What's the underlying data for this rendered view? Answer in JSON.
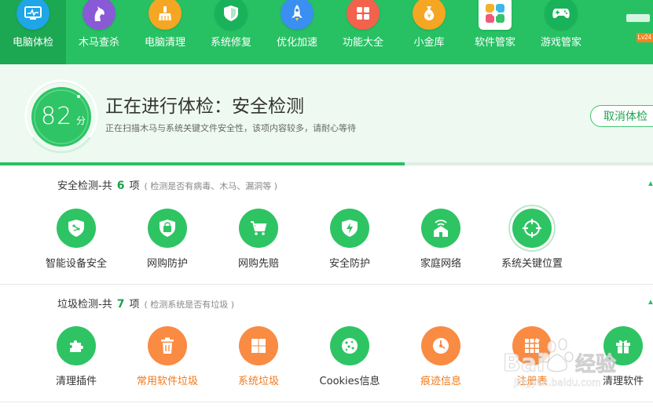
{
  "nav": {
    "items": [
      {
        "label": "电脑体检",
        "icon": "monitor-check-icon",
        "color": "#1ea6e8",
        "active": true
      },
      {
        "label": "木马查杀",
        "icon": "horse-icon",
        "color": "#8a5ad6"
      },
      {
        "label": "电脑清理",
        "icon": "broom-icon",
        "color": "#f5a623"
      },
      {
        "label": "系统修复",
        "icon": "shield-icon",
        "color": "#19b25a"
      },
      {
        "label": "优化加速",
        "icon": "rocket-icon",
        "color": "#3a8ff0"
      },
      {
        "label": "功能大全",
        "icon": "grid-icon",
        "color": "#f2624d"
      },
      {
        "label": "小金库",
        "icon": "money-bag-icon",
        "color": "#f5a623"
      },
      {
        "label": "软件管家",
        "icon": "software-icon",
        "color": "#ffffff"
      },
      {
        "label": "游戏管家",
        "icon": "gamepad-icon",
        "color": "#19b25a"
      }
    ],
    "level_badge": "Lv24"
  },
  "status": {
    "score": "82",
    "score_unit": "分",
    "title": "正在进行体检：安全检测",
    "subtitle": "正在扫描木马与系统关键文件安全性，该项内容较多，请耐心等待",
    "cancel_label": "取消体检",
    "progress_percent": 62
  },
  "security": {
    "title": "安全检测-共",
    "count": "6",
    "unit": "项",
    "note": "( 检测是否有病毒、木马、漏洞等 )",
    "items": [
      {
        "label": "智能设备安全",
        "icon": "smart-device-shield-icon",
        "style": "green"
      },
      {
        "label": "网购防护",
        "icon": "shopping-bag-shield-icon",
        "style": "green"
      },
      {
        "label": "网购先赔",
        "icon": "shopping-cart-icon",
        "style": "green"
      },
      {
        "label": "安全防护",
        "icon": "lightning-shield-icon",
        "style": "green"
      },
      {
        "label": "家庭网络",
        "icon": "home-wifi-icon",
        "style": "green"
      },
      {
        "label": "系统关键位置",
        "icon": "crosshair-icon",
        "style": "green-ringed"
      }
    ]
  },
  "junk": {
    "title": "垃圾检测-共",
    "count": "7",
    "unit": "项",
    "note": "( 检测系统是否有垃圾 )",
    "items": [
      {
        "label": "清理插件",
        "icon": "puzzle-icon",
        "style": "green"
      },
      {
        "label": "常用软件垃圾",
        "icon": "trash-icon",
        "style": "orange"
      },
      {
        "label": "系统垃圾",
        "icon": "windows-icon",
        "style": "orange"
      },
      {
        "label": "Cookies信息",
        "icon": "cookie-icon",
        "style": "green"
      },
      {
        "label": "痕迹信息",
        "icon": "trace-clock-icon",
        "style": "orange"
      },
      {
        "label": "注册表",
        "icon": "registry-grid-icon",
        "style": "orange"
      },
      {
        "label": "清理软件",
        "icon": "gift-box-icon",
        "style": "green"
      }
    ]
  },
  "watermark": {
    "text": "Baidu经验",
    "sub": "jingyan.baidu.com"
  }
}
